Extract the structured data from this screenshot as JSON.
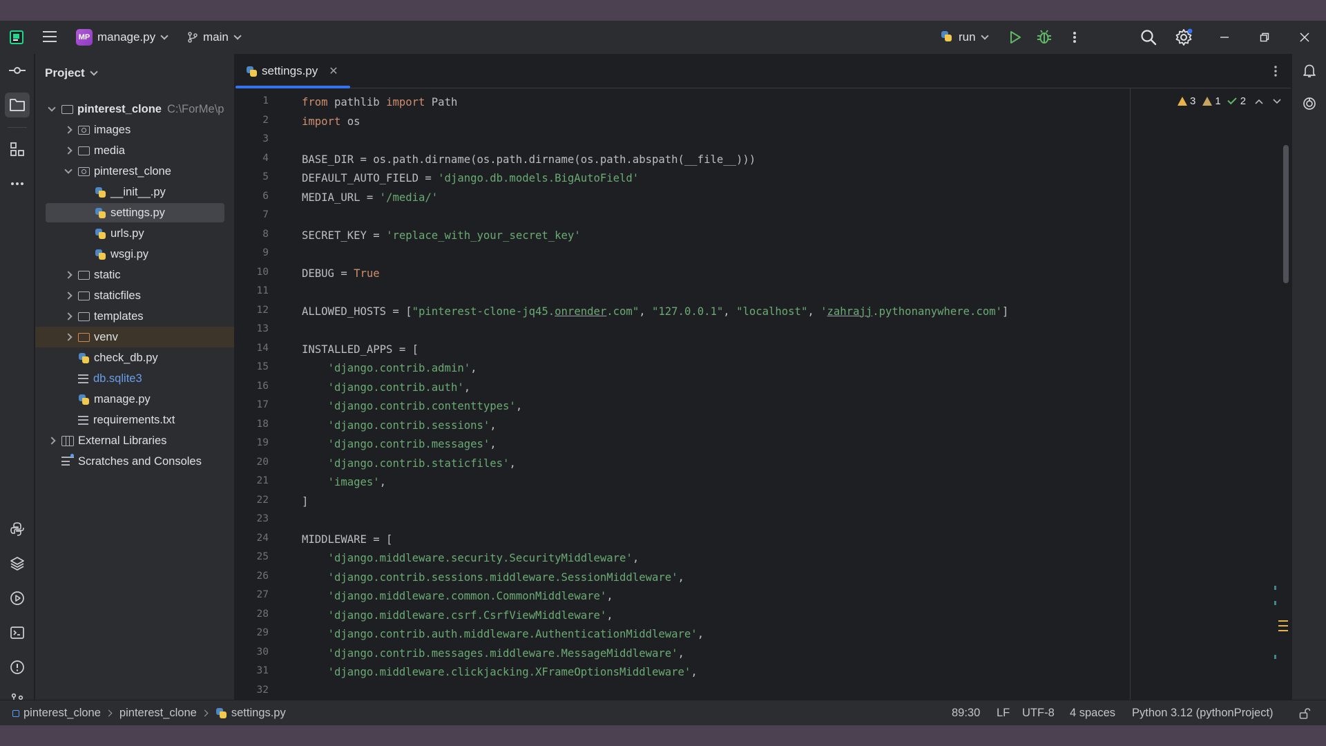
{
  "titlebar": {
    "project_badge": "MP",
    "project_name": "manage.py",
    "branch": "main",
    "run_config": "run"
  },
  "project_panel": {
    "title": "Project",
    "tree": [
      {
        "label": "pinterest_clone",
        "hint": "C:\\ForMe\\p",
        "indent": 0,
        "kind": "folder",
        "state": "open"
      },
      {
        "label": "images",
        "indent": 1,
        "kind": "folder-src",
        "state": "closed"
      },
      {
        "label": "media",
        "indent": 1,
        "kind": "folder",
        "state": "closed"
      },
      {
        "label": "pinterest_clone",
        "indent": 1,
        "kind": "folder-src",
        "state": "open"
      },
      {
        "label": "__init__.py",
        "indent": 2,
        "kind": "py"
      },
      {
        "label": "settings.py",
        "indent": 2,
        "kind": "py",
        "selected": true
      },
      {
        "label": "urls.py",
        "indent": 2,
        "kind": "py"
      },
      {
        "label": "wsgi.py",
        "indent": 2,
        "kind": "py"
      },
      {
        "label": "static",
        "indent": 1,
        "kind": "folder",
        "state": "closed"
      },
      {
        "label": "staticfiles",
        "indent": 1,
        "kind": "folder",
        "state": "closed"
      },
      {
        "label": "templates",
        "indent": 1,
        "kind": "folder",
        "state": "closed"
      },
      {
        "label": "venv",
        "indent": 1,
        "kind": "folder-excl",
        "state": "closed",
        "excluded": true
      },
      {
        "label": "check_db.py",
        "indent": 1,
        "kind": "py"
      },
      {
        "label": "db.sqlite3",
        "indent": 1,
        "kind": "txt",
        "color": "#6a9ee8"
      },
      {
        "label": "manage.py",
        "indent": 1,
        "kind": "py"
      },
      {
        "label": "requirements.txt",
        "indent": 1,
        "kind": "txt"
      },
      {
        "label": "External Libraries",
        "indent": 0,
        "kind": "lib",
        "state": "closed"
      },
      {
        "label": "Scratches and Consoles",
        "indent": 0,
        "kind": "scratch"
      }
    ]
  },
  "editor": {
    "tab_label": "settings.py",
    "inspections": {
      "warnings": "3",
      "weak_warnings": "1",
      "checks": "2"
    },
    "lines": [
      [
        [
          "kw",
          "from"
        ],
        [
          "t",
          " pathlib "
        ],
        [
          "kw",
          "import"
        ],
        [
          "t",
          " Path"
        ]
      ],
      [
        [
          "kw",
          "import"
        ],
        [
          "t",
          " os"
        ]
      ],
      [],
      [
        [
          "t",
          "BASE_DIR = os.path.dirname(os.path.dirname(os.path.abspath(__file__)))"
        ]
      ],
      [
        [
          "t",
          "DEFAULT_AUTO_FIELD = "
        ],
        [
          "str",
          "'django.db.models.BigAutoField'"
        ]
      ],
      [
        [
          "t",
          "MEDIA_URL = "
        ],
        [
          "str",
          "'/media/'"
        ]
      ],
      [],
      [
        [
          "t",
          "SECRET_KEY = "
        ],
        [
          "str",
          "'replace_with_your_secret_key'"
        ]
      ],
      [],
      [
        [
          "t",
          "DEBUG = "
        ],
        [
          "kw",
          "True"
        ]
      ],
      [],
      [
        [
          "t",
          "ALLOWED_HOSTS = ["
        ],
        [
          "str",
          "\"pinterest-clone-jq45."
        ],
        [
          "strul",
          "onrender"
        ],
        [
          "str",
          ".com\""
        ],
        [
          "t",
          ", "
        ],
        [
          "str",
          "\"127.0.0.1\""
        ],
        [
          "t",
          ", "
        ],
        [
          "str",
          "\"localhost\""
        ],
        [
          "t",
          ", "
        ],
        [
          "str",
          "'"
        ],
        [
          "strul",
          "zahrajj"
        ],
        [
          "str",
          ".pythonanywhere.com'"
        ],
        [
          "t",
          "]"
        ]
      ],
      [],
      [
        [
          "t",
          "INSTALLED_APPS = ["
        ]
      ],
      [
        [
          "t",
          "    "
        ],
        [
          "str",
          "'django.contrib.admin'"
        ],
        [
          "t",
          ","
        ]
      ],
      [
        [
          "t",
          "    "
        ],
        [
          "str",
          "'django.contrib.auth'"
        ],
        [
          "t",
          ","
        ]
      ],
      [
        [
          "t",
          "    "
        ],
        [
          "str",
          "'django.contrib.contenttypes'"
        ],
        [
          "t",
          ","
        ]
      ],
      [
        [
          "t",
          "    "
        ],
        [
          "str",
          "'django.contrib.sessions'"
        ],
        [
          "t",
          ","
        ]
      ],
      [
        [
          "t",
          "    "
        ],
        [
          "str",
          "'django.contrib.messages'"
        ],
        [
          "t",
          ","
        ]
      ],
      [
        [
          "t",
          "    "
        ],
        [
          "str",
          "'django.contrib.staticfiles'"
        ],
        [
          "t",
          ","
        ]
      ],
      [
        [
          "t",
          "    "
        ],
        [
          "str",
          "'images'"
        ],
        [
          "t",
          ","
        ]
      ],
      [
        [
          "t",
          "]"
        ]
      ],
      [],
      [
        [
          "t",
          "MIDDLEWARE = ["
        ]
      ],
      [
        [
          "t",
          "    "
        ],
        [
          "str",
          "'django.middleware.security.SecurityMiddleware'"
        ],
        [
          "t",
          ","
        ]
      ],
      [
        [
          "t",
          "    "
        ],
        [
          "str",
          "'django.contrib.sessions.middleware.SessionMiddleware'"
        ],
        [
          "t",
          ","
        ]
      ],
      [
        [
          "t",
          "    "
        ],
        [
          "str",
          "'django.middleware.common.CommonMiddleware'"
        ],
        [
          "t",
          ","
        ]
      ],
      [
        [
          "t",
          "    "
        ],
        [
          "str",
          "'django.middleware.csrf.CsrfViewMiddleware'"
        ],
        [
          "t",
          ","
        ]
      ],
      [
        [
          "t",
          "    "
        ],
        [
          "str",
          "'django.contrib.auth.middleware.AuthenticationMiddleware'"
        ],
        [
          "t",
          ","
        ]
      ],
      [
        [
          "t",
          "    "
        ],
        [
          "str",
          "'django.contrib.messages.middleware.MessageMiddleware'"
        ],
        [
          "t",
          ","
        ]
      ],
      [
        [
          "t",
          "    "
        ],
        [
          "str",
          "'django.middleware.clickjacking.XFrameOptionsMiddleware'"
        ],
        [
          "t",
          ","
        ]
      ],
      []
    ]
  },
  "statusbar": {
    "breadcrumbs": [
      "pinterest_clone",
      "pinterest_clone",
      "settings.py"
    ],
    "caret": "89:30",
    "line_sep": "LF",
    "encoding": "UTF-8",
    "indent": "4 spaces",
    "interpreter": "Python 3.12 (pythonProject)"
  },
  "colors": {
    "accent": "#3574f0",
    "keyword": "#cf8e6d",
    "string": "#6aab73",
    "warning": "#e8b44a"
  }
}
